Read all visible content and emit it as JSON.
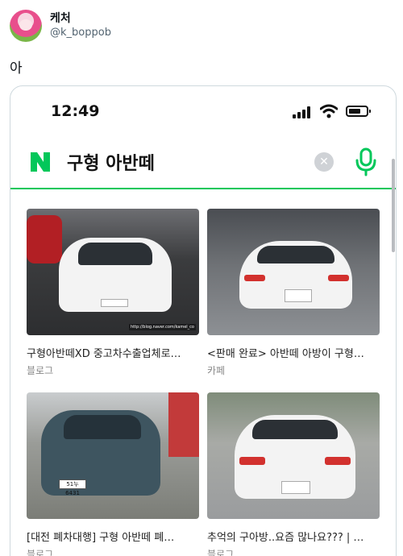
{
  "tweet": {
    "display_name": "케처",
    "handle": "@k_boppob",
    "text": "아"
  },
  "phone": {
    "time": "12:49",
    "search": {
      "logo": "N",
      "query": "구형 아반떼",
      "clear_icon": "clear-icon",
      "mic_icon": "microphone-icon",
      "accent": "#03c75a"
    }
  },
  "results": [
    {
      "title": "구형아반떼XD 중고차수출업체로…",
      "source": "블로그",
      "watermark": "http://blog.naver.com/kamel_co"
    },
    {
      "title": "<판매 완료> 아반떼 아방이 구형…",
      "source": "카페"
    },
    {
      "title": "[대전 폐차대행] 구형 아반떼 폐…",
      "source": "블로그",
      "plate": "51누6431"
    },
    {
      "title": "추억의 구아방..요즘 많나요??? | …",
      "source": "블로그"
    }
  ]
}
